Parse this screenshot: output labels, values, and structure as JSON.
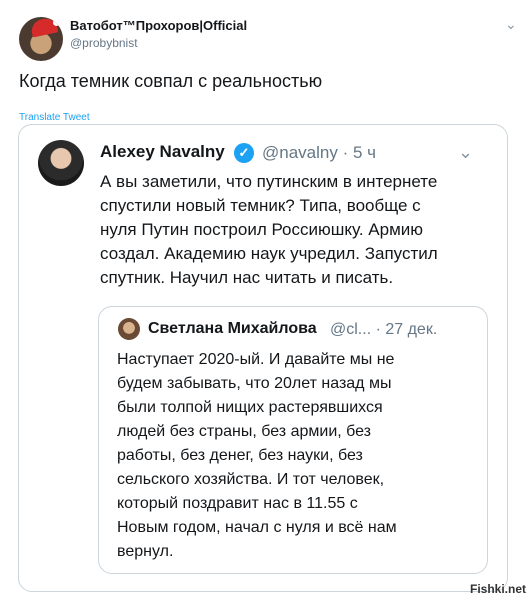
{
  "author": {
    "name": "Ватобот™Прохоров|Official",
    "handle": "@probybnist"
  },
  "tweet": {
    "text": "Когда темник совпал с реальностью",
    "translate_label": "Translate Tweet"
  },
  "quoted": {
    "name": "Alexey Navalny",
    "verified_icon": "checkmark-icon",
    "meta": "@navalny · 5 ч",
    "lines": [
      "А вы заметили, что путинским в интернете",
      "спустили новый темник? Типа, вообще с",
      "нуля Путин построил Россиюшку. Армию",
      "создал. Академию наук учредил. Запустил",
      "спутник. Научил нас читать и писать."
    ]
  },
  "nested": {
    "name": "Светлана Михайлова",
    "meta": "@cl... · 27 дек.",
    "lines": [
      "Наступает 2020-ый. И давайте мы не",
      "будем забывать, что 20лет назад мы",
      "были толпой нищих растерявшихся",
      "людей без страны, без армии, без",
      "работы, без денег, без науки, без",
      "сельского хозяйства. И тот человек,",
      "который поздравит нас в 11.55 с",
      "Новым годом, начал с нуля и всё нам",
      "вернул."
    ]
  },
  "watermark": "Fishki.net",
  "colors": {
    "accent": "#1da1f2",
    "text": "#14171a",
    "muted": "#657786",
    "border": "#ccd6dd"
  }
}
